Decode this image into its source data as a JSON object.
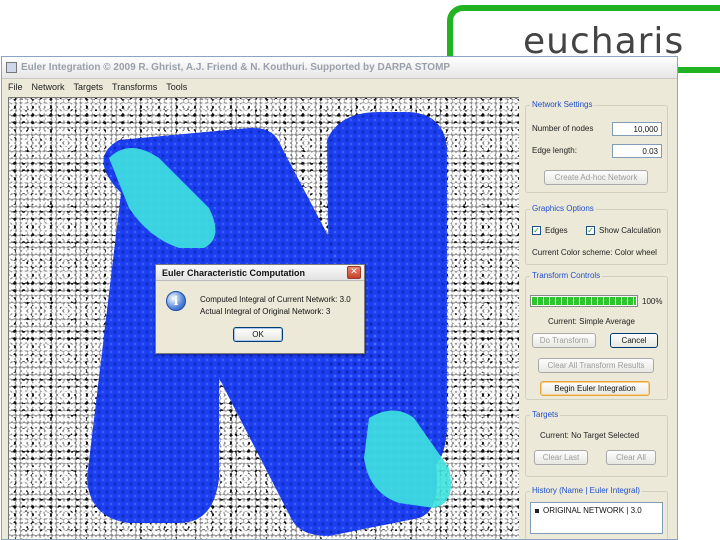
{
  "slide": {
    "logo_text": "eucharis"
  },
  "window": {
    "title": "Euler Integration © 2009 R. Ghrist, A.J. Friend & N. Kouthuri. Supported by DARPA STOMP",
    "menu": [
      "File",
      "Network",
      "Targets",
      "Transforms",
      "Tools"
    ]
  },
  "network_settings": {
    "title": "Network Settings",
    "nodes_label": "Number of nodes",
    "nodes_value": "10,000",
    "edge_label": "Edge length:",
    "edge_value": "0.03",
    "create_button": "Create Ad-hoc Network"
  },
  "graphics_options": {
    "title": "Graphics Options",
    "edges_label": "Edges",
    "edges_checked": true,
    "calc_label": "Show Calculation",
    "calc_checked": true,
    "color_scheme": "Current Color scheme: Color wheel"
  },
  "transform_controls": {
    "title": "Transform Controls",
    "progress_text": "100%",
    "progress_fraction": 1.0,
    "current": "Current: Simple Average",
    "do_button": "Do Transform",
    "cancel_button": "Cancel",
    "clear_button": "Clear All Transform Results",
    "begin_button": "Begin Euler Integration"
  },
  "targets": {
    "title": "Targets",
    "current": "Current: No Target Selected",
    "clear_last": "Clear Last",
    "clear_all": "Clear All"
  },
  "history": {
    "title": "History (Name | Euler Integral)",
    "items": [
      {
        "text": "ORIGINAL NETWORK | 3.0"
      }
    ]
  },
  "dialog": {
    "title": "Euler Characteristic Computation",
    "line1": "Computed Integral of Current Network: 3.0",
    "line2": "Actual Integral of Original Network: 3",
    "ok": "OK",
    "close_glyph": "✕",
    "info_glyph": "i"
  },
  "colors": {
    "blob_blue": "#1b3ef0",
    "blob_cyan": "#3fe3e0",
    "accent_green": "#22b322",
    "group_title": "#1f4fcc"
  }
}
